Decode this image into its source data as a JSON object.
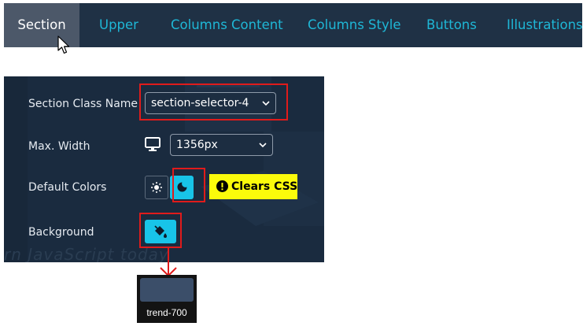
{
  "tabs": [
    {
      "label": "Section",
      "active": true
    },
    {
      "label": "Upper",
      "active": false
    },
    {
      "label": "Columns Content",
      "active": false
    },
    {
      "label": "Columns Style",
      "active": false
    },
    {
      "label": "Buttons",
      "active": false
    },
    {
      "label": "Illustrations",
      "active": false
    }
  ],
  "panel": {
    "section_class": {
      "label": "Section Class Name",
      "value": "section-selector-4"
    },
    "max_width": {
      "label": "Max. Width",
      "value": "1356px",
      "icon": "monitor-icon"
    },
    "default_colors": {
      "label": "Default Colors",
      "light_icon": "sun-icon",
      "dark_icon": "moon-icon",
      "selected": "dark",
      "warning": "Clears CSS"
    },
    "background": {
      "label": "Background",
      "icon": "paint-bucket-icon"
    },
    "faded_background_text": "rn JavaScript today"
  },
  "swatch": {
    "label": "trend-700",
    "color": "#3b4e69"
  },
  "colors": {
    "tabbar_bg": "#1f3145",
    "tab_active_bg": "#4c5869",
    "tab_text": "#1fb7d6",
    "panel_bg": "#1a2b3f",
    "accent": "#18c4e8",
    "highlight": "#e01b1b",
    "warning_bg": "#fbfb0b"
  }
}
